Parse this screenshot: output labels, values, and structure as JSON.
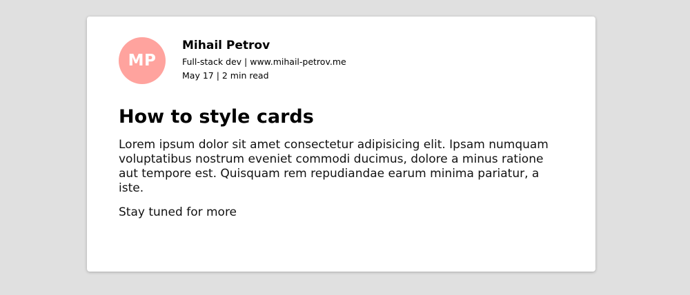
{
  "colors": {
    "background": "#e0e0e0",
    "card": "#ffffff",
    "avatar": "#ffa39e"
  },
  "author": {
    "initials": "MP",
    "name": "Mihail Petrov",
    "role_line": "Full-stack dev | www.mihail-petrov.me",
    "meta_line": "May 17 | 2 min read"
  },
  "post": {
    "title": "How to style cards",
    "body": "Lorem ipsum dolor sit amet consectetur adipisicing elit. Ipsam numquam voluptatibus nostrum eveniet commodi ducimus, dolore a minus ratione aut tempore est. Quisquam rem repudiandae earum minima pariatur, a iste.",
    "footer": "Stay tuned for more"
  }
}
